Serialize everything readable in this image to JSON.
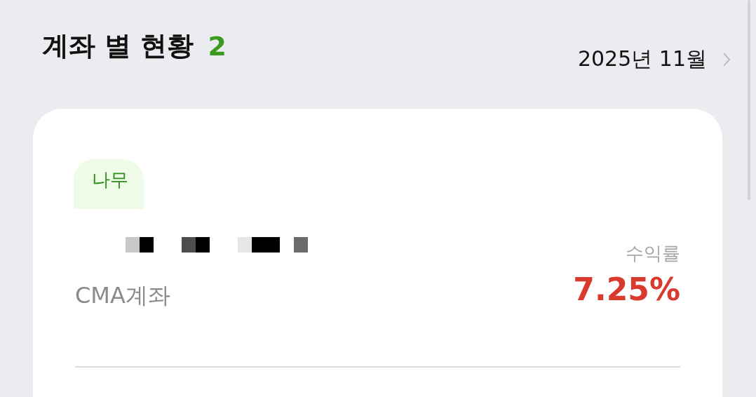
{
  "header": {
    "title": "계좌 별 현황",
    "count": "2",
    "period": "2025년 11월"
  },
  "card": {
    "badge": "나무",
    "account_type": "CMA계좌",
    "return_label": "수익률",
    "return_value": "7.25%"
  }
}
